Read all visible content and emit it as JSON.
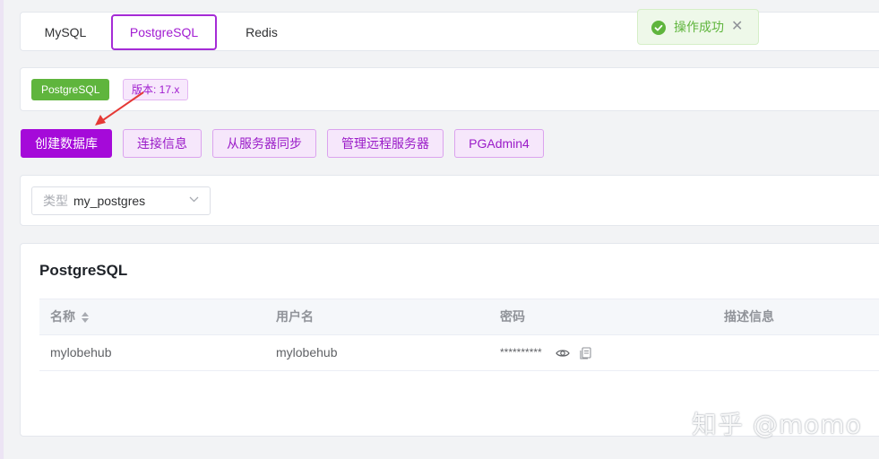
{
  "tabs": [
    {
      "label": "MySQL",
      "active": false
    },
    {
      "label": "PostgreSQL",
      "active": true
    },
    {
      "label": "Redis",
      "active": false
    }
  ],
  "toast": {
    "message": "操作成功",
    "type": "success",
    "icon": "check-circle-icon"
  },
  "version": {
    "db_badge": "PostgreSQL",
    "version_badge": "版本: 17.x"
  },
  "actions": {
    "create_db": "创建数据库",
    "connection_info": "连接信息",
    "sync_from_server": "从服务器同步",
    "manage_remote": "管理远程服务器",
    "pgadmin": "PGAdmin4"
  },
  "filter": {
    "prefix": "类型",
    "value": "my_postgres"
  },
  "table": {
    "title": "PostgreSQL",
    "columns": [
      "名称",
      "用户名",
      "密码",
      "描述信息"
    ],
    "rows": [
      {
        "name": "mylobehub",
        "username": "mylobehub",
        "password": "**********",
        "description": ""
      }
    ]
  },
  "watermark": "知乎 @momo",
  "colors": {
    "accent": "#a50ad9",
    "success": "#5fb53d",
    "annotation_arrow": "#e53935"
  }
}
